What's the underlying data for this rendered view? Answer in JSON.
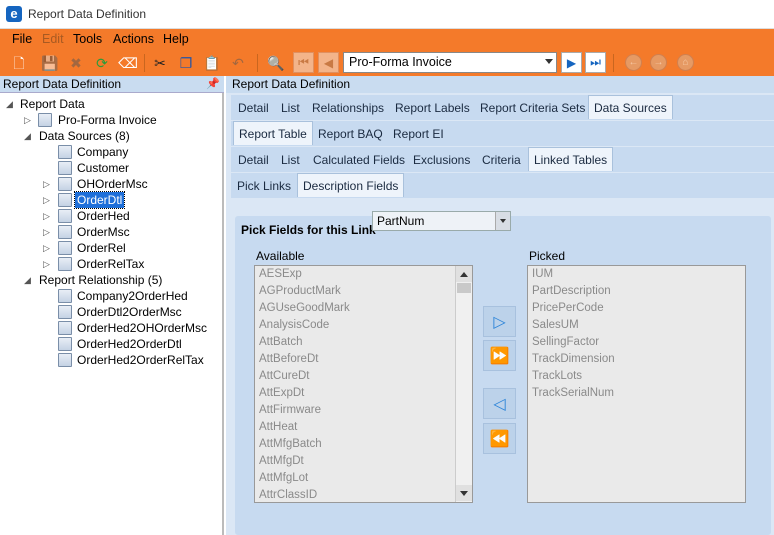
{
  "window": {
    "title": "Report Data Definition"
  },
  "menu": [
    "File",
    "Edit",
    "Tools",
    "Actions",
    "Help"
  ],
  "toolbar": {
    "record": "Pro-Forma Invoice"
  },
  "left_panel": {
    "header": "Report Data Definition",
    "tree": {
      "root": "Report Data",
      "report": "Pro-Forma Invoice",
      "data_sources_label": "Data Sources (8)",
      "data_sources": [
        "Company",
        "Customer",
        "OHOrderMsc",
        "OrderDtl",
        "OrderHed",
        "OrderMsc",
        "OrderRel",
        "OrderRelTax"
      ],
      "selected": "OrderDtl",
      "relationships_label": "Report Relationship (5)",
      "relationships": [
        "Company2OrderHed",
        "OrderDtl2OrderMsc",
        "OrderHed2OHOrderMsc",
        "OrderHed2OrderDtl",
        "OrderHed2OrderRelTax"
      ]
    }
  },
  "right_panel": {
    "header": "Report Data Definition",
    "tabs1": [
      "Detail",
      "List",
      "Relationships",
      "Report Labels",
      "Report Criteria Sets",
      "Data Sources"
    ],
    "tabs2": [
      "Report Table",
      "Report BAQ",
      "Report EI"
    ],
    "tabs3": [
      "Detail",
      "List",
      "Calculated Fields",
      "Exclusions",
      "Criteria",
      "Linked Tables"
    ],
    "tabs4": [
      "Pick Links",
      "Description Fields"
    ],
    "pick": {
      "label": "Pick Fields for this Link",
      "value": "PartNum",
      "available_title": "Available",
      "available": [
        "AESExp",
        "AGProductMark",
        "AGUseGoodMark",
        "AnalysisCode",
        "AttBatch",
        "AttBeforeDt",
        "AttCureDt",
        "AttExpDt",
        "AttFirmware",
        "AttHeat",
        "AttMfgBatch",
        "AttMfgDt",
        "AttMfgLot",
        "AttrClassID"
      ],
      "picked_title": "Picked",
      "picked": [
        "IUM",
        "PartDescription",
        "PricePerCode",
        "SalesUM",
        "SellingFactor",
        "TrackDimension",
        "TrackLots",
        "TrackSerialNum"
      ]
    }
  },
  "colors": {
    "accent": "#f47a2a",
    "selection": "#1e6fd9",
    "panel": "#dbe7f5"
  }
}
